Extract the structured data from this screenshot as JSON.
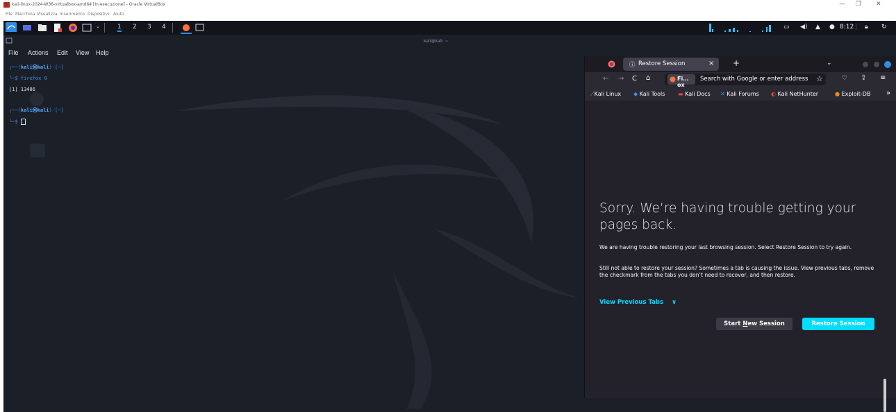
{
  "virtualbox": {
    "window_title": "kali-linux-2024-W36-virtualbox-amd64 [In esecuzione] - Oracle VirtualBox",
    "menu": [
      "File",
      "Macchina",
      "Visualizza",
      "Inserimento",
      "Dispositivi",
      "Aiuto"
    ],
    "controls": {
      "minimize": "—",
      "restore": "❐",
      "close": "✕"
    }
  },
  "panel": {
    "workspaces": [
      "1",
      "2",
      "3",
      "4"
    ],
    "clock": "8:12"
  },
  "terminal": {
    "window_title": "kali@kali: ~",
    "menu": [
      "File",
      "Actions",
      "Edit",
      "View",
      "Help"
    ],
    "lines": {
      "prompt1_top": "┌──(",
      "prompt1_user": "kali㉿kali",
      "prompt1_dir": ")-[~]",
      "cmd1_prefix": "└─$ ",
      "cmd1": "firefox 0",
      "output1": "[1] 13486",
      "prompt2_top": "┌──(",
      "prompt2_user": "kali㉿kali",
      "prompt2_dir": ")-[~]",
      "cmd2_prefix": "└─$ "
    }
  },
  "firefox": {
    "tab_title": "Restore Session",
    "tab_close": "×",
    "new_tab": "+",
    "identity_label": "Fi…ox",
    "url_placeholder": "Search with Google or enter address",
    "bookmarks": [
      "Kali Linux",
      "Kali Tools",
      "Kali Docs",
      "Kali Forums",
      "Kali NetHunter",
      "Exploit-DB"
    ],
    "bookmarks_overflow": "»",
    "error": {
      "title": "Sorry. We’re having trouble getting your pages back.",
      "para1": "We are having trouble restoring your last browsing session. Select Restore Session to try again.",
      "para2": "Still not able to restore your session? Sometimes a tab is causing the issue. View previous tabs, remove the checkmark from the tabs you don’t need to recover, and then restore.",
      "view_previous_tabs": "View Previous Tabs",
      "start_new_prefix": "Start ",
      "start_new_key": "N",
      "start_new_suffix": "ew Session",
      "restore_button": "Restore Session"
    },
    "colors": {
      "accent": "#00ddff",
      "primary_button": "#00ddff"
    }
  }
}
